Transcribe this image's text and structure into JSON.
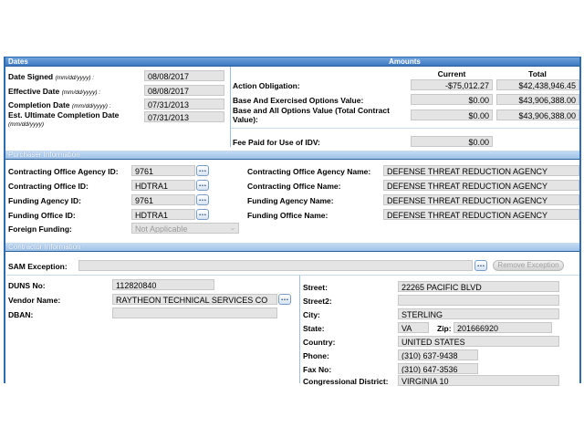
{
  "dates": {
    "header": "Dates",
    "hint": "(mm/dd/yyyy) :",
    "hint_plain": "(mm/dd/yyyy)",
    "date_signed": {
      "label": "Date Signed",
      "value": "08/08/2017"
    },
    "effective_date": {
      "label": "Effective Date",
      "value": "08/08/2017"
    },
    "completion_date": {
      "label": "Completion Date",
      "value": "07/31/2013"
    },
    "est_ultimate_completion": {
      "label": "Est. Ultimate Completion Date",
      "value": "07/31/2013"
    }
  },
  "amounts": {
    "header": "Amounts",
    "col_current": "Current",
    "col_total": "Total",
    "rows": [
      {
        "label": "Action Obligation:",
        "current": "-$75,012.27",
        "total": "$42,438,946.45"
      },
      {
        "label": "Base And Exercised Options Value:",
        "current": "$0.00",
        "total": "$43,906,388.00"
      },
      {
        "label": "Base and All Options Value (Total Contract Value):",
        "current": "$0.00",
        "total": "$43,906,388.00"
      }
    ],
    "fee_label": "Fee Paid for Use of IDV:",
    "fee_value": "$0.00"
  },
  "purchaser": {
    "header": "Purchaser Information",
    "contracting_office_agency_id": {
      "label": "Contracting Office Agency ID:",
      "value": "9761"
    },
    "contracting_office_id": {
      "label": "Contracting Office ID:",
      "value": "HDTRA1"
    },
    "funding_agency_id": {
      "label": "Funding Agency ID:",
      "value": "9761"
    },
    "funding_office_id": {
      "label": "Funding Office ID:",
      "value": "HDTRA1"
    },
    "foreign_funding": {
      "label": "Foreign Funding:",
      "value": "Not Applicable"
    },
    "contracting_office_agency_name": {
      "label": "Contracting Office Agency Name:",
      "value": "DEFENSE THREAT REDUCTION AGENCY"
    },
    "contracting_office_name": {
      "label": "Contracting Office Name:",
      "value": "DEFENSE THREAT REDUCTION AGENCY"
    },
    "funding_agency_name": {
      "label": "Funding Agency Name:",
      "value": "DEFENSE THREAT REDUCTION AGENCY"
    },
    "funding_office_name": {
      "label": "Funding Office Name:",
      "value": "DEFENSE THREAT REDUCTION AGENCY"
    }
  },
  "contractor": {
    "header": "Contractor Information",
    "sam_exception": {
      "label": "SAM Exception:",
      "value": ""
    },
    "remove_exception_label": "Remove Exception",
    "duns": {
      "label": "DUNS No:",
      "value": "112820840"
    },
    "vendor_name": {
      "label": "Vendor Name:",
      "value": "RAYTHEON TECHNICAL SERVICES CO"
    },
    "dban": {
      "label": "DBAN:",
      "value": ""
    },
    "street": {
      "label": "Street:",
      "value": "22265 PACIFIC BLVD"
    },
    "street2": {
      "label": "Street2:",
      "value": ""
    },
    "city": {
      "label": "City:",
      "value": "STERLING"
    },
    "state": {
      "label": "State:",
      "value": "VA"
    },
    "zip": {
      "label": "Zip:",
      "value": "201666920"
    },
    "country": {
      "label": "Country:",
      "value": "UNITED STATES"
    },
    "phone": {
      "label": "Phone:",
      "value": "(310) 637-9438"
    },
    "fax": {
      "label": "Fax No:",
      "value": "(310) 647-3536"
    },
    "congressional_district": {
      "label": "Congressional District:",
      "value": "VIRGINIA 10"
    }
  },
  "icons": {
    "lookup": "ellipsis-lookup-icon",
    "dropdown": "chevron-down-icon"
  },
  "colors": {
    "header_blue": "#3d78bf",
    "section_light_blue": "#9fc1e8",
    "field_gray": "#e4e4e4",
    "border_blue": "#2e6db4"
  }
}
